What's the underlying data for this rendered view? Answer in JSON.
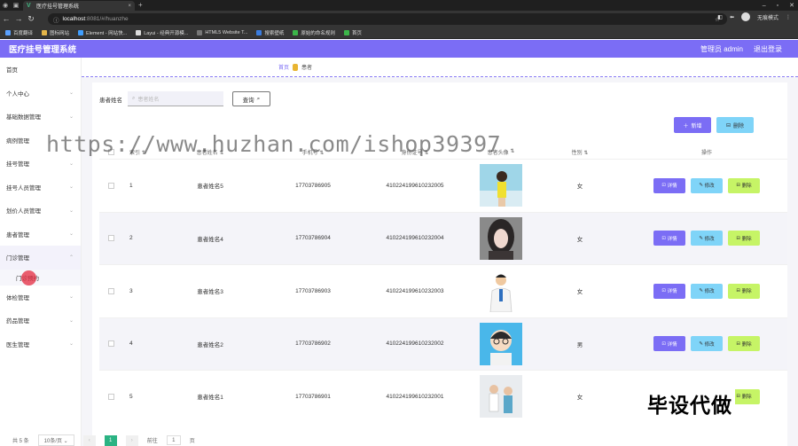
{
  "browser": {
    "tab_title": "医疗挂号管理系统",
    "url_host": "localhost",
    "url_rest": ":8081/#/huanzhe",
    "profile_label": "无痕模式",
    "bookmarks": [
      "百度翻译",
      "图标网站",
      "Element - 网站快...",
      "Layui - 经典开源模...",
      "HTML5 Website T...",
      "搜索壁纸",
      "原始的命名规则",
      "首页"
    ]
  },
  "header": {
    "title": "医疗挂号管理系统",
    "user": "管理员 admin",
    "logout": "退出登录"
  },
  "sidebar": {
    "items": [
      {
        "label": "首页"
      },
      {
        "label": "个人中心"
      },
      {
        "label": "基础数据管理"
      },
      {
        "label": "病例管理"
      },
      {
        "label": "挂号管理"
      },
      {
        "label": "挂号人员管理"
      },
      {
        "label": "划价人员管理"
      },
      {
        "label": "患者管理"
      },
      {
        "label": "门诊管理"
      },
      {
        "label": "门诊预约"
      },
      {
        "label": "体检管理"
      },
      {
        "label": "药品管理"
      },
      {
        "label": "医生管理"
      }
    ]
  },
  "breadcrumb": {
    "home": "首页",
    "current": "患者"
  },
  "search": {
    "label": "患者姓名",
    "placeholder": "患者姓名",
    "button": "查询"
  },
  "toolbar": {
    "add": "新增",
    "delete": "删除"
  },
  "table": {
    "headers": [
      "索引",
      "患者姓名",
      "手机号",
      "身份证号",
      "患者头像",
      "性别",
      "操作"
    ],
    "rows": [
      {
        "idx": "1",
        "name": "患者姓名5",
        "phone": "17703786905",
        "id": "410224199610232005",
        "sex": "女",
        "avatar": "woman-yellow-top"
      },
      {
        "idx": "2",
        "name": "患者姓名4",
        "phone": "17703786904",
        "id": "410224199610232004",
        "sex": "女",
        "avatar": "woman-portrait"
      },
      {
        "idx": "3",
        "name": "患者姓名3",
        "phone": "17703786903",
        "id": "410224199610232003",
        "sex": "女",
        "avatar": "doctor-cartoon"
      },
      {
        "idx": "4",
        "name": "患者姓名2",
        "phone": "17703786902",
        "id": "410224199610232002",
        "sex": "男",
        "avatar": "boy-cartoon"
      },
      {
        "idx": "5",
        "name": "患者姓名1",
        "phone": "17703786901",
        "id": "410224199610232001",
        "sex": "女",
        "avatar": "medical-staff"
      }
    ],
    "ops": {
      "detail": "详情",
      "edit": "修改",
      "remove": "删除"
    }
  },
  "pager": {
    "total": "共 5 条",
    "size": "10条/页",
    "current": "1",
    "goto": "前往",
    "page_value": "1",
    "unit": "页"
  },
  "overlay": {
    "watermark": "https://www.huzhan.com/ishop39397",
    "stamp": "毕设代做"
  },
  "colors": {
    "accent": "#7b6df5",
    "cyan": "#7fd4f8",
    "lime": "#c6f466"
  }
}
